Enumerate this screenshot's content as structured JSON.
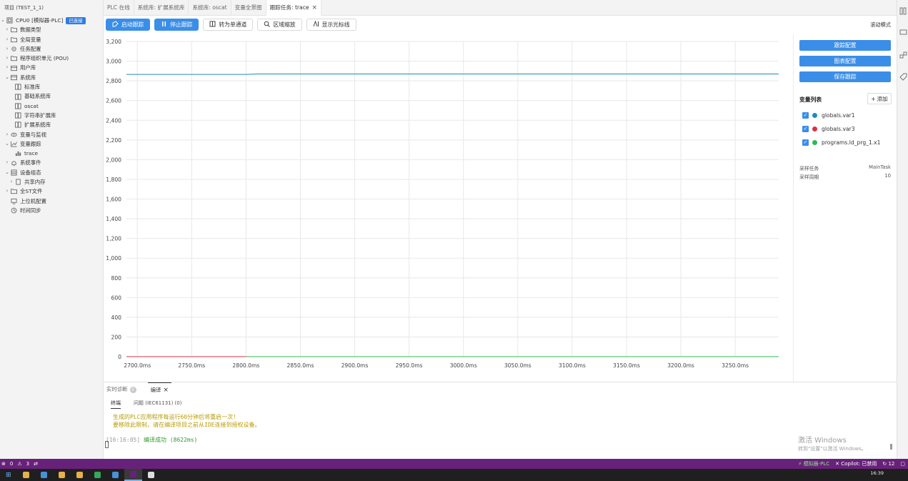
{
  "sidebar": {
    "title": "项目 (TEST_1_1)",
    "root_label": "CPU0 [模拟器-PLC]",
    "root_badge": "已连接",
    "items": [
      {
        "label": "数据类型",
        "chevron": "›",
        "icon": "folder-icon",
        "indent": 1
      },
      {
        "label": "全局变量",
        "chevron": "›",
        "icon": "folder-icon",
        "indent": 1
      },
      {
        "label": "任务配置",
        "chevron": "›",
        "icon": "gear-icon",
        "indent": 1
      },
      {
        "label": "程序组织单元 (POU)",
        "chevron": "›",
        "icon": "folder-icon",
        "indent": 1
      },
      {
        "label": "用户库",
        "chevron": "›",
        "icon": "library-icon",
        "indent": 1
      },
      {
        "label": "系统库",
        "chevron": "⌄",
        "icon": "library-icon",
        "indent": 1
      },
      {
        "label": "标准库",
        "chevron": "",
        "icon": "book-icon",
        "indent": 2
      },
      {
        "label": "基础系统库",
        "chevron": "",
        "icon": "book-icon",
        "indent": 2
      },
      {
        "label": "oscat",
        "chevron": "",
        "icon": "book-icon",
        "indent": 2
      },
      {
        "label": "字符串扩展库",
        "chevron": "",
        "icon": "book-icon",
        "indent": 2
      },
      {
        "label": "扩展系统库",
        "chevron": "",
        "icon": "book-icon",
        "indent": 2
      },
      {
        "label": "变量与监视",
        "chevron": "›",
        "icon": "eye-icon",
        "indent": 1
      },
      {
        "label": "变量跟踪",
        "chevron": "⌄",
        "icon": "chart-icon",
        "indent": 1
      },
      {
        "label": "trace",
        "chevron": "",
        "icon": "bar-chart-icon",
        "indent": 2
      },
      {
        "label": "系统事件",
        "chevron": "›",
        "icon": "bell-icon",
        "indent": 1
      },
      {
        "label": "设备组态",
        "chevron": "⌄",
        "icon": "device-icon",
        "indent": 1
      },
      {
        "label": "共享内存",
        "chevron": "›",
        "icon": "memory-icon",
        "indent": 2
      },
      {
        "label": "全ST文件",
        "chevron": "›",
        "icon": "folder-icon",
        "indent": 1
      },
      {
        "label": "上位机配置",
        "chevron": "",
        "icon": "monitor-icon",
        "indent": 1
      },
      {
        "label": "时间同步",
        "chevron": "",
        "icon": "clock-icon",
        "indent": 1
      }
    ]
  },
  "tabs": [
    {
      "label": "PLC 在线",
      "active": false
    },
    {
      "label": "系统库: 扩展系统库",
      "active": false
    },
    {
      "label": "系统库: oscat",
      "active": false
    },
    {
      "label": "变量全景图",
      "active": false
    },
    {
      "label": "跟踪任务: trace",
      "active": true
    }
  ],
  "toolbar": {
    "start": "启动跟踪",
    "stop": "停止跟踪",
    "single_channel": "转为单通道",
    "zoom": "区域缩放",
    "cursor": "显示光标线",
    "mode": "滚动模式"
  },
  "right_panel": {
    "trace_config": "跟踪配置",
    "chart_config": "图表配置",
    "save_trace": "保存跟踪",
    "var_list_title": "变量列表",
    "add_label": "添加",
    "variables": [
      {
        "name": "globals.var1",
        "color": "#1f8ac0"
      },
      {
        "name": "globals.var3",
        "color": "#d6334a"
      },
      {
        "name": "programs.ld_prg_1.x1",
        "color": "#2fb84f"
      }
    ],
    "sample_task_label": "采样任务",
    "sample_task_value": "MainTask",
    "sample_period_label": "采样周期",
    "sample_period_value": "10"
  },
  "chart_data": {
    "type": "line",
    "x_ticks": [
      "2700.0ms",
      "2750.0ms",
      "2800.0ms",
      "2850.0ms",
      "2900.0ms",
      "2950.0ms",
      "3000.0ms",
      "3050.0ms",
      "3100.0ms",
      "3150.0ms",
      "3200.0ms",
      "3250.0ms"
    ],
    "y_ticks": [
      "3,200",
      "3,000",
      "2,800",
      "2,600",
      "2,400",
      "2,200",
      "2,000",
      "1,800",
      "1,600",
      "1,400",
      "1,200",
      "1,000",
      "800",
      "600",
      "400",
      "200",
      "0"
    ],
    "xlim": [
      2690,
      3290
    ],
    "ylim": [
      0,
      3200
    ],
    "grid": true,
    "series": [
      {
        "name": "globals.var1",
        "color": "#1f8ac0",
        "x": [
          2690,
          2800,
          2810,
          3290
        ],
        "y": [
          2865,
          2865,
          2870,
          2870
        ]
      },
      {
        "name": "globals.var3",
        "color": "#d6334a",
        "x": [
          2690,
          2800
        ],
        "y": [
          0,
          0
        ]
      },
      {
        "name": "programs.ld_prg_1.x1",
        "color": "#2fb84f",
        "x": [
          2800,
          3290
        ],
        "y": [
          0,
          0
        ]
      }
    ]
  },
  "bottom": {
    "tab_diag": "实时诊断",
    "tab_diag_count": "0",
    "tab_compile": "编译",
    "sub_terminal": "终端",
    "sub_problems": "问题 (IEC61131) (0)",
    "warn1": "生成的PLC应用程序每运行60分钟后将重启一次!",
    "warn2": "要移除此限制，请在编译项目之前从IDE连接到授权设备。",
    "ts": "[16:16:05]",
    "success": "编译成功 (8622ms)",
    "watermark1": "激活 Windows",
    "watermark2": "转到\"设置\"以激活 Windows。"
  },
  "statusbar": {
    "errors": "0",
    "warnings": "3",
    "plc": "模拟器-PLC",
    "copilot": "Copilot: 已禁用",
    "notifications": "12"
  },
  "taskbar": {
    "clock": "16:39"
  }
}
